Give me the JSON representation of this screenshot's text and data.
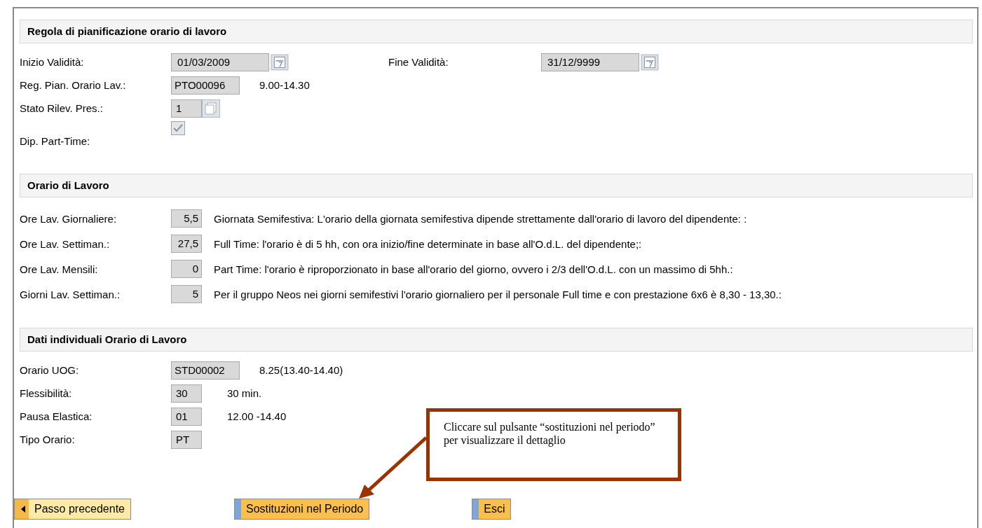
{
  "sections": [
    {
      "title": "Regola di pianificazione orario di lavoro",
      "rows": [
        {
          "kind": "date",
          "label": "Inizio Validità:",
          "value": "01/03/2009",
          "label_2": "Fine Validità:",
          "value_2": "31/12/9999"
        },
        {
          "kind": "code",
          "label": "Reg. Pian. Orario Lav.:",
          "value": "PTO00096",
          "note": "9.00-14.30"
        },
        {
          "kind": "lookup",
          "label": "Stato Rilev. Pres.:",
          "value": "1"
        },
        {
          "kind": "checkbox",
          "label": "Dip. Part-Time:",
          "checked": true
        }
      ]
    },
    {
      "title": "Orario di Lavoro",
      "rows": [
        {
          "kind": "number",
          "label": "Ore Lav. Giornaliere:",
          "value": "5,5",
          "note": "Giornata Semifestiva: L'orario della giornata semifestiva dipende strettamente dall'orario di lavoro del dipendente: :"
        },
        {
          "kind": "number",
          "label": "Ore Lav. Settiman.:",
          "value": "27,5",
          "note": "Full Time: l'orario è di 5 hh, con ora inizio/fine determinate in base all'O.d.L. del dipendente;:"
        },
        {
          "kind": "number",
          "label": "Ore Lav. Mensili:",
          "value": "0",
          "note": "Part Time: l'orario è riproporzionato in base all'orario del giorno, ovvero i 2/3 dell'O.d.L. con un massimo di 5hh.:"
        },
        {
          "kind": "number",
          "label": "Giorni Lav. Settiman.:",
          "value": "5",
          "note": "Per il gruppo Neos nei giorni semifestivi l'orario giornaliero per il personale Full time e con prestazione 6x6 è 8,30 - 13,30.:"
        }
      ]
    },
    {
      "title": "Dati individuali Orario di Lavoro",
      "rows": [
        {
          "kind": "code",
          "label": "Orario UOG:",
          "value": "STD00002",
          "note": "8.25(13.40-14.40)"
        },
        {
          "kind": "short",
          "label": "Flessibilità:",
          "value": "30",
          "note": "30 min."
        },
        {
          "kind": "short",
          "label": "Pausa Elastica:",
          "value": "01",
          "note": "12.00 -14.40"
        },
        {
          "kind": "short",
          "label": "Tipo Orario:",
          "value": "PT"
        }
      ]
    }
  ],
  "callout": {
    "text": "Cliccare sul pulsante “sostituzioni nel periodo” per visualizzare il dettaglio"
  },
  "buttons": [
    {
      "kind": "back",
      "label": "Passo precedente"
    },
    {
      "kind": "primary",
      "label": "Sostituzioni nel Periodo"
    },
    {
      "kind": "primary",
      "label": "Esci"
    }
  ]
}
